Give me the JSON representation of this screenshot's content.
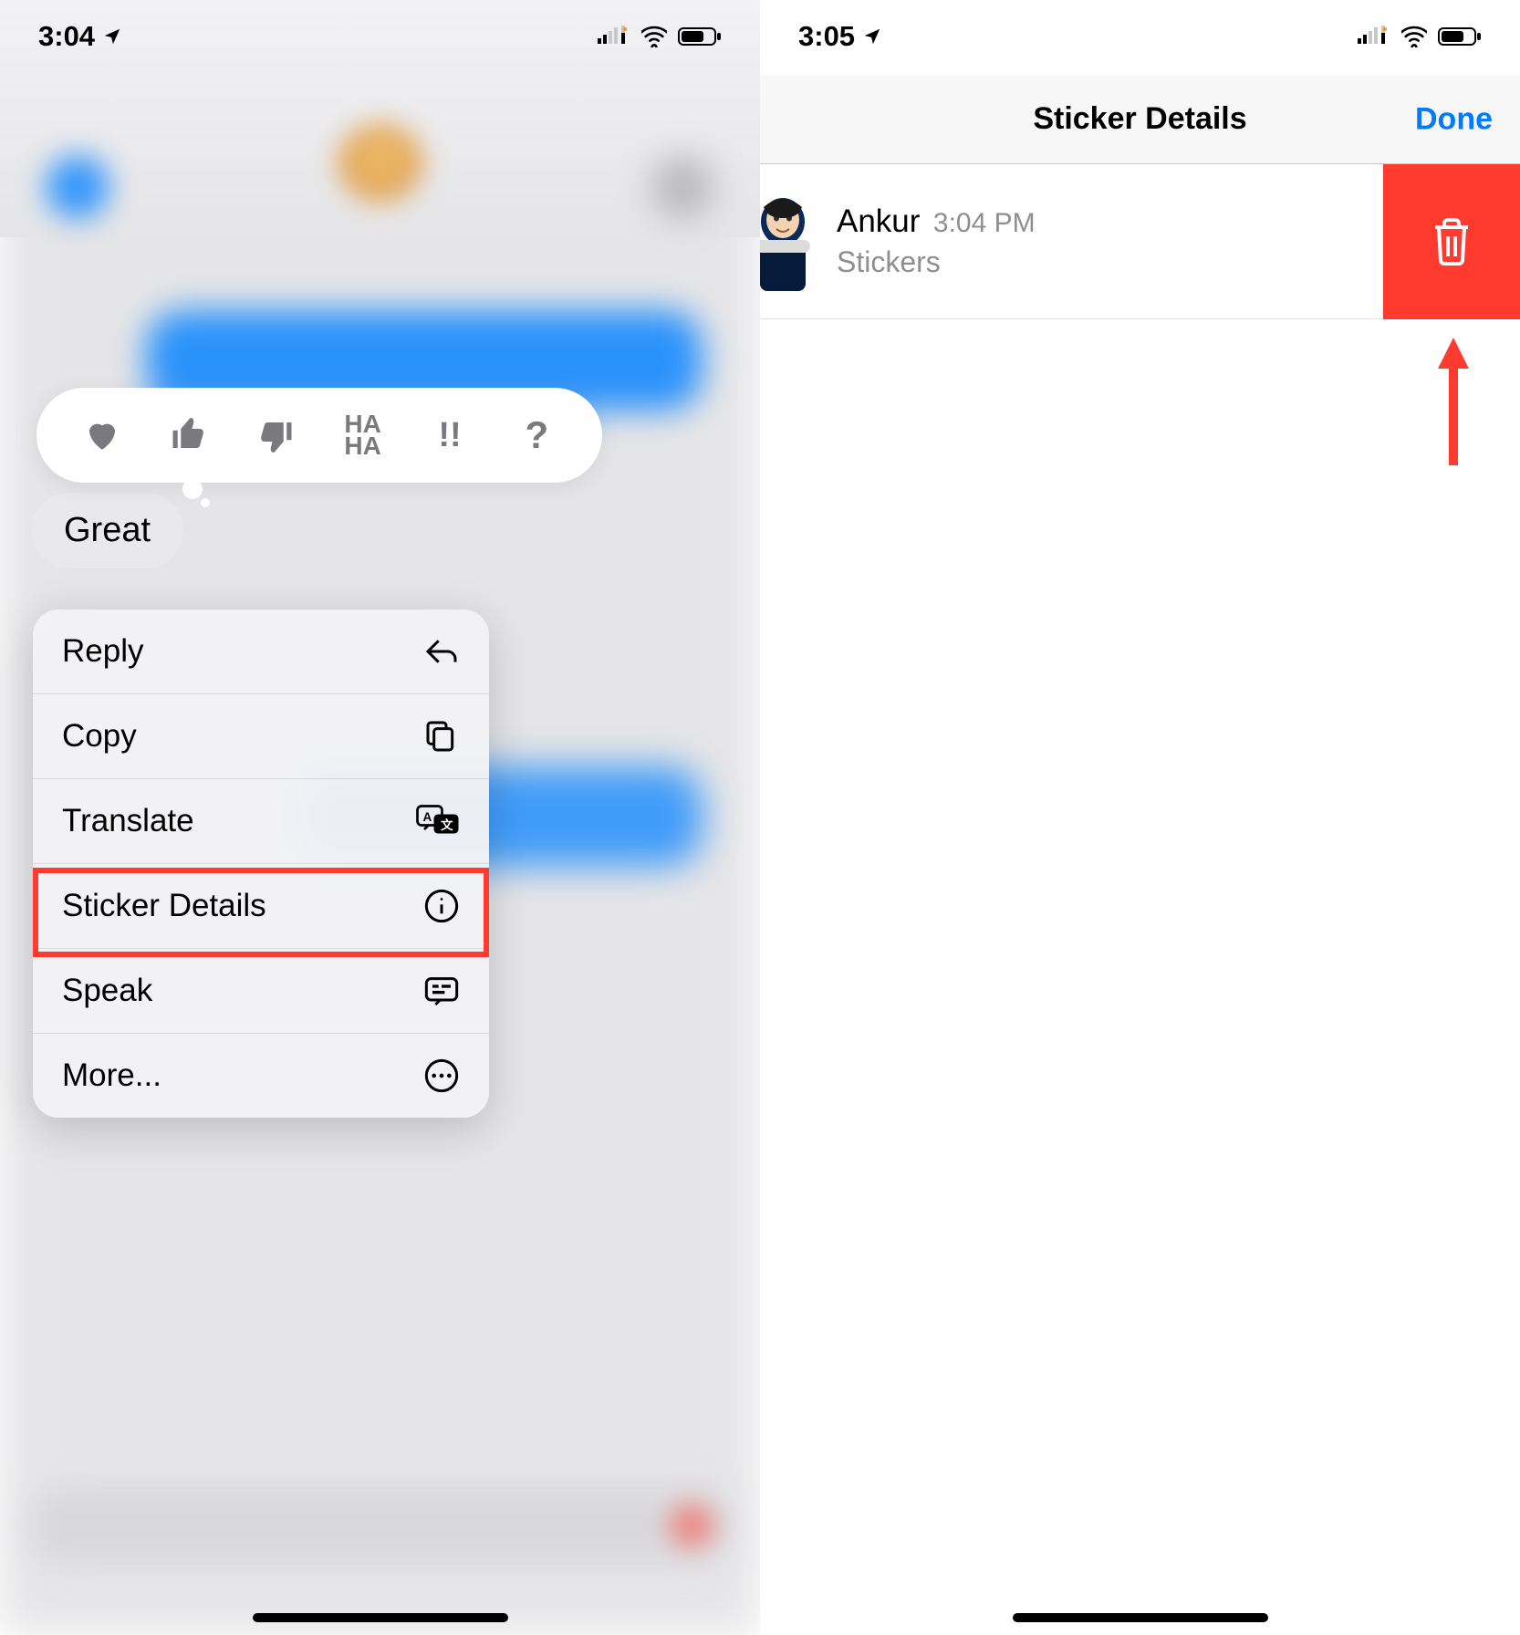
{
  "left": {
    "statusbar": {
      "time": "3:04"
    },
    "tapbacks": {
      "haha": "HA\nHA",
      "exclaim": "!!",
      "question": "?"
    },
    "message": "Great",
    "menu": {
      "reply": "Reply",
      "copy": "Copy",
      "translate": "Translate",
      "sticker_details": "Sticker Details",
      "speak": "Speak",
      "more": "More..."
    }
  },
  "right": {
    "statusbar": {
      "time": "3:05"
    },
    "nav": {
      "title": "Sticker Details",
      "done": "Done"
    },
    "row": {
      "name": "Ankur",
      "time": "3:04 PM",
      "subtitle": "Stickers"
    }
  }
}
